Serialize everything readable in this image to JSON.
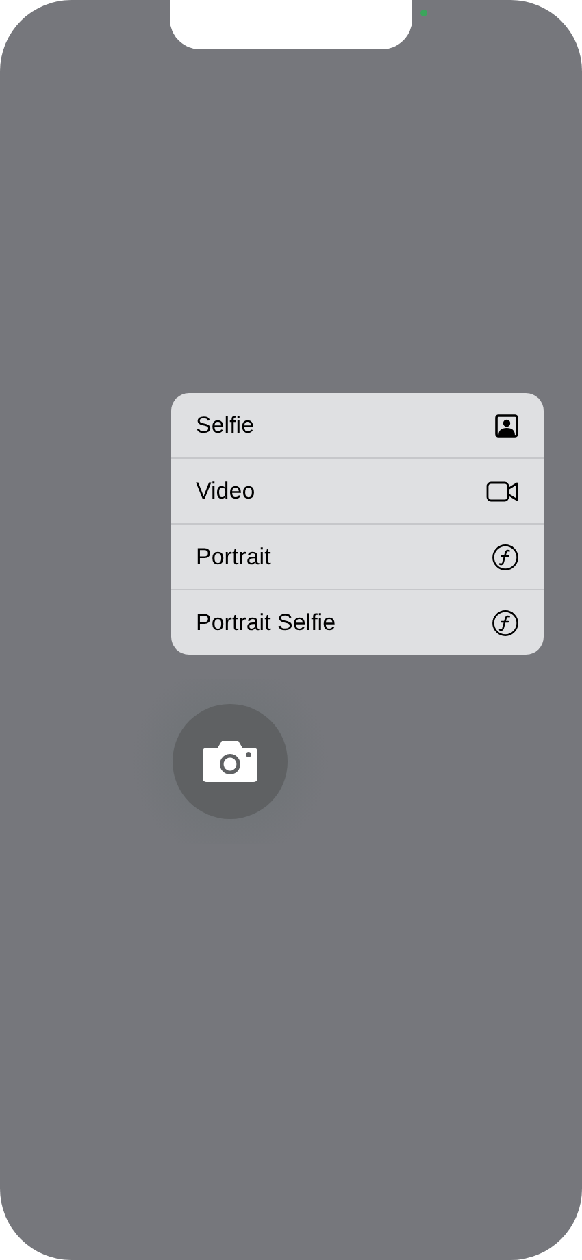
{
  "menu": {
    "items": [
      {
        "label": "Selfie",
        "kind": "selfie"
      },
      {
        "label": "Video",
        "kind": "video"
      },
      {
        "label": "Portrait",
        "kind": "portrait"
      },
      {
        "label": "Portrait Selfie",
        "kind": "portrait"
      }
    ]
  }
}
